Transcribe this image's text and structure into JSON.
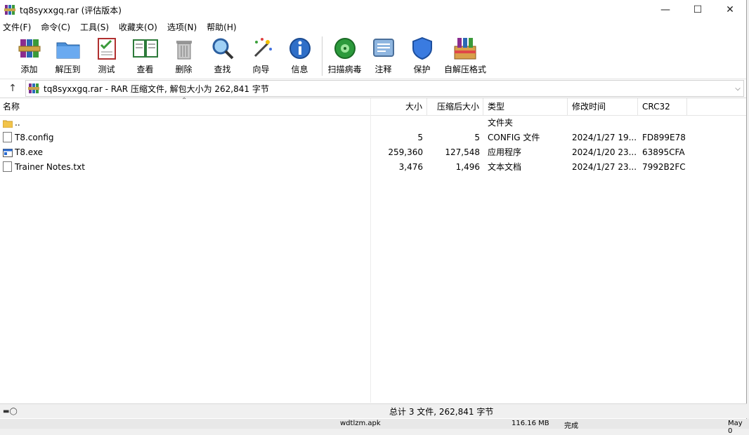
{
  "window": {
    "title": "tq8syxxgq.rar (评估版本)",
    "controls": {
      "minimize": "—",
      "maximize": "☐",
      "close": "✕"
    }
  },
  "menu": [
    "文件(F)",
    "命令(C)",
    "工具(S)",
    "收藏夹(O)",
    "选项(N)",
    "帮助(H)"
  ],
  "toolbar": [
    {
      "label": "添加",
      "icon": "add-archive-icon"
    },
    {
      "label": "解压到",
      "icon": "extract-to-icon"
    },
    {
      "label": "测试",
      "icon": "test-icon"
    },
    {
      "label": "查看",
      "icon": "view-icon"
    },
    {
      "label": "删除",
      "icon": "delete-icon"
    },
    {
      "label": "查找",
      "icon": "find-icon"
    },
    {
      "label": "向导",
      "icon": "wizard-icon"
    },
    {
      "label": "信息",
      "icon": "info-icon"
    },
    {
      "label": "扫描病毒",
      "icon": "virus-scan-icon"
    },
    {
      "label": "注释",
      "icon": "comment-icon"
    },
    {
      "label": "保护",
      "icon": "protect-icon"
    },
    {
      "label": "自解压格式",
      "icon": "sfx-icon"
    }
  ],
  "address": {
    "up": "↑",
    "path": "tq8syxxgq.rar - RAR 压缩文件, 解包大小为 262,841 字节"
  },
  "columns": {
    "name": "名称",
    "size": "大小",
    "packed": "压缩后大小",
    "type": "类型",
    "modified": "修改时间",
    "crc": "CRC32"
  },
  "files": [
    {
      "name": "..",
      "size": "",
      "packed": "",
      "type": "文件夹",
      "modified": "",
      "crc": "",
      "icon": "folder-icon"
    },
    {
      "name": "T8.config",
      "size": "5",
      "packed": "5",
      "type": "CONFIG 文件",
      "modified": "2024/1/27 19...",
      "crc": "FD899E78",
      "icon": "file-icon"
    },
    {
      "name": "T8.exe",
      "size": "259,360",
      "packed": "127,548",
      "type": "应用程序",
      "modified": "2024/1/20 23...",
      "crc": "63895CFA",
      "icon": "exe-icon"
    },
    {
      "name": "Trainer Notes.txt",
      "size": "3,476",
      "packed": "1,496",
      "type": "文本文档",
      "modified": "2024/1/27 23...",
      "crc": "7992B2FC",
      "icon": "text-file-icon"
    }
  ],
  "status": {
    "summary": "总计 3 文件, 262,841 字节"
  },
  "background_window": {
    "file": "wdtlzm.apk",
    "size": "116.16 MB",
    "state": "完成",
    "date": "May 0"
  }
}
